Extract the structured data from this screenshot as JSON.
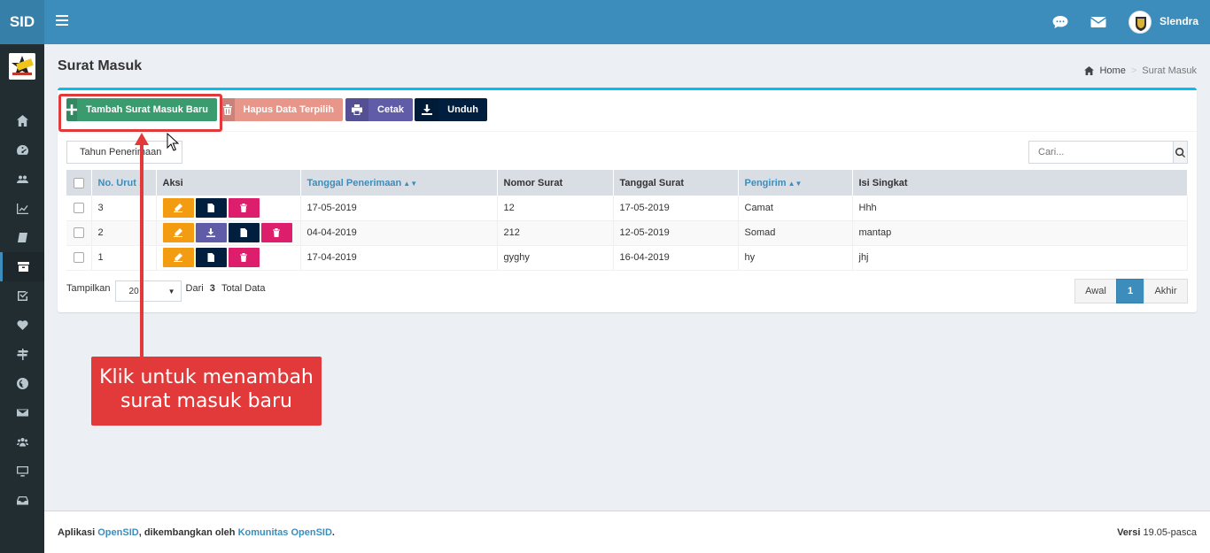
{
  "header": {
    "logo_text": "SID",
    "user_name": "Slendra"
  },
  "sidebar": {
    "items": [
      {
        "icon": "home-icon"
      },
      {
        "icon": "dashboard-icon"
      },
      {
        "icon": "users-icon"
      },
      {
        "icon": "chart-icon"
      },
      {
        "icon": "book-icon"
      },
      {
        "icon": "archive-icon",
        "active": true
      },
      {
        "icon": "check-square-icon"
      },
      {
        "icon": "heart-icon"
      },
      {
        "icon": "signpost-icon"
      },
      {
        "icon": "globe-icon"
      },
      {
        "icon": "envelope-icon"
      },
      {
        "icon": "group-icon"
      },
      {
        "icon": "desktop-icon"
      },
      {
        "icon": "inbox-icon"
      }
    ]
  },
  "page": {
    "title": "Surat Masuk",
    "breadcrumb_home": "Home",
    "breadcrumb_sep": ">",
    "breadcrumb_current": "Surat Masuk"
  },
  "toolbar": {
    "add_label": "Tambah Surat Masuk Baru",
    "delete_label": "Hapus Data Terpilih",
    "print_label": "Cetak",
    "download_label": "Unduh",
    "add_color": "#3a9b6e",
    "delete_color": "#e8968a",
    "print_color": "#605ca8",
    "download_color": "#001f3f"
  },
  "filter": {
    "year_placeholder": "Tahun Penerimaan"
  },
  "search": {
    "placeholder": "Cari..."
  },
  "table": {
    "headers": {
      "no": "No. Urut",
      "aksi": "Aksi",
      "tanggal_penerimaan": "Tanggal Penerimaan",
      "nomor_surat": "Nomor Surat",
      "tanggal_surat": "Tanggal Surat",
      "pengirim": "Pengirim",
      "isi": "Isi Singkat"
    },
    "rows": [
      {
        "no": "3",
        "tanggal_penerimaan": "17-05-2019",
        "nomor_surat": "12",
        "tanggal_surat": "17-05-2019",
        "pengirim": "Camat",
        "isi": "Hhh"
      },
      {
        "no": "2",
        "tanggal_penerimaan": "04-04-2019",
        "nomor_surat": "212",
        "tanggal_surat": "12-05-2019",
        "pengirim": "Somad",
        "isi": "mantap"
      },
      {
        "no": "1",
        "tanggal_penerimaan": "17-04-2019",
        "nomor_surat": "gyghy",
        "tanggal_surat": "16-04-2019",
        "pengirim": "hy",
        "isi": "jhj"
      }
    ]
  },
  "paging": {
    "show_label": "Tampilkan",
    "per_page": "20",
    "from_label": "Dari",
    "total": "3",
    "total_label": "Total Data",
    "first": "Awal",
    "current": "1",
    "last": "Akhir"
  },
  "annotation": {
    "line1": "Klik untuk menambah",
    "line2": "surat masuk baru",
    "color": "#e23a3a"
  },
  "footer": {
    "prefix": "Aplikasi",
    "app_link": "OpenSID",
    "middle": ", dikembangkan oleh",
    "community_link": "Komunitas OpenSID",
    "suffix": ".",
    "version_label": "Versi",
    "version": "19.05-pasca"
  }
}
